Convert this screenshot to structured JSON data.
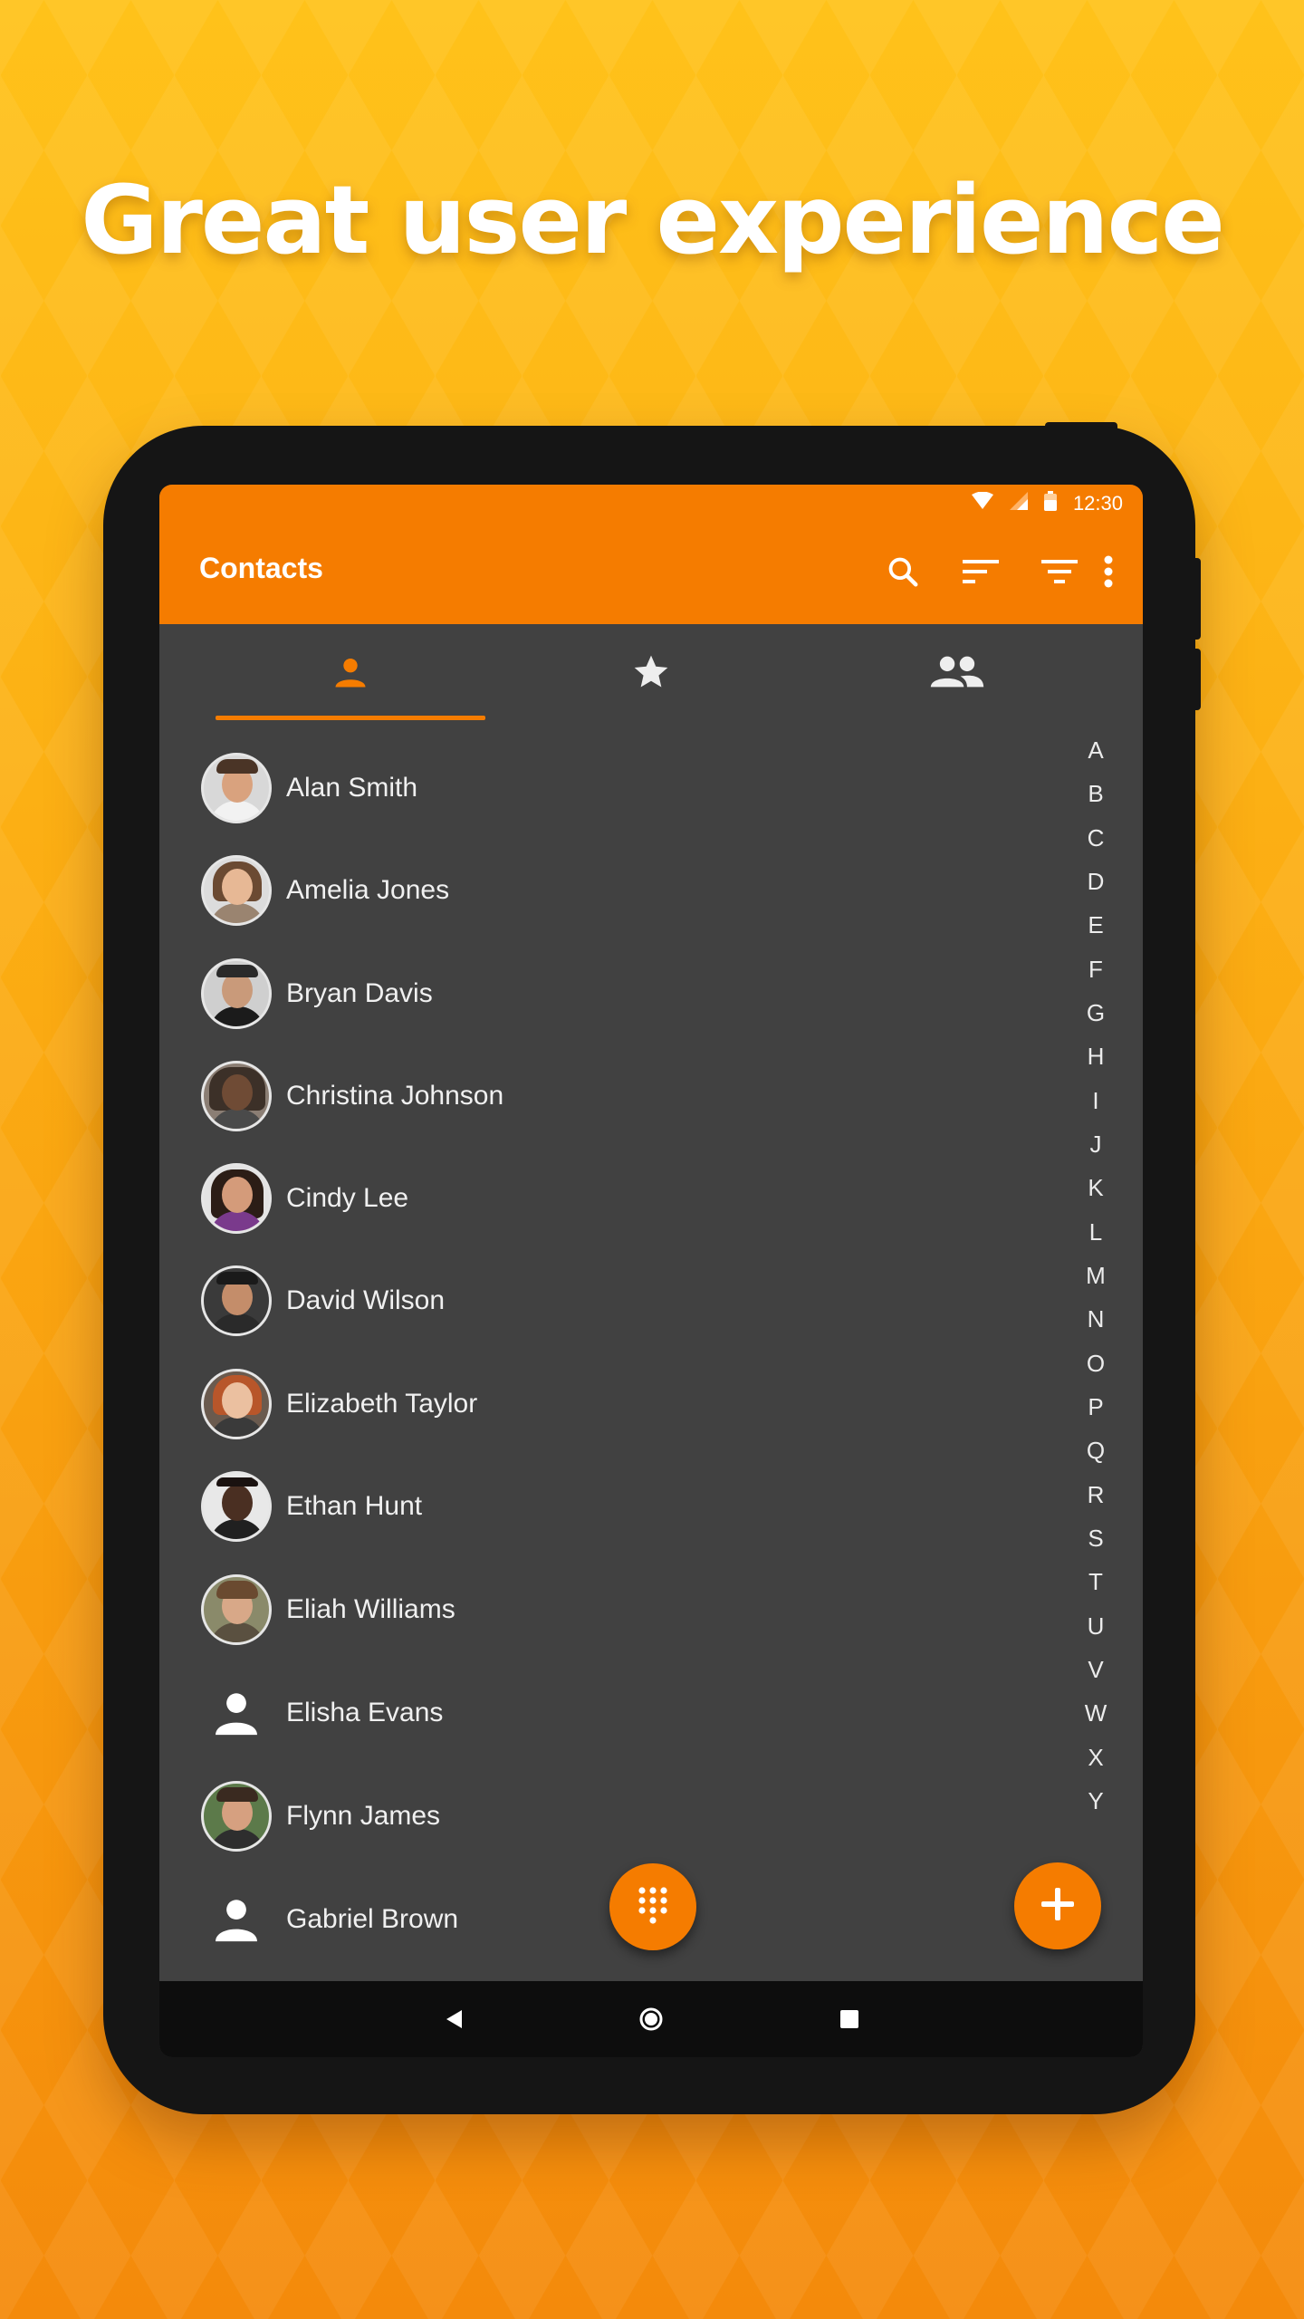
{
  "headline": "Great user experience",
  "status_bar": {
    "time": "12:30",
    "icons": [
      "wifi-icon",
      "signal-icon",
      "battery-icon"
    ]
  },
  "toolbar": {
    "title": "Contacts",
    "actions": [
      "search-icon",
      "sort-icon",
      "filter-icon",
      "more-vertical-icon"
    ]
  },
  "tabs": [
    {
      "icon": "person-icon",
      "selected": true
    },
    {
      "icon": "star-icon",
      "selected": false
    },
    {
      "icon": "group-icon",
      "selected": false
    }
  ],
  "contacts": [
    {
      "name": "Alan Smith",
      "has_photo": true
    },
    {
      "name": "Amelia Jones",
      "has_photo": true
    },
    {
      "name": "Bryan Davis",
      "has_photo": true
    },
    {
      "name": "Christina Johnson",
      "has_photo": true
    },
    {
      "name": "Cindy Lee",
      "has_photo": true
    },
    {
      "name": "David Wilson",
      "has_photo": true
    },
    {
      "name": "Elizabeth Taylor",
      "has_photo": true
    },
    {
      "name": "Ethan Hunt",
      "has_photo": true
    },
    {
      "name": "Eliah Williams",
      "has_photo": true
    },
    {
      "name": "Elisha Evans",
      "has_photo": false
    },
    {
      "name": "Flynn James",
      "has_photo": true
    },
    {
      "name": "Gabriel Brown",
      "has_photo": false
    }
  ],
  "alphabet": [
    "A",
    "B",
    "C",
    "D",
    "E",
    "F",
    "G",
    "H",
    "I",
    "J",
    "K",
    "L",
    "M",
    "N",
    "O",
    "P",
    "Q",
    "R",
    "S",
    "T",
    "U",
    "V",
    "W",
    "X",
    "Y"
  ],
  "fabs": [
    "dialpad-icon",
    "add-icon"
  ],
  "nav_bar": [
    "back-icon",
    "home-icon",
    "recents-icon"
  ],
  "colors": {
    "accent": "#f57c00",
    "screen_background": "#414141",
    "device_frame": "#151515",
    "nav_bar": "#0d0d0d"
  }
}
